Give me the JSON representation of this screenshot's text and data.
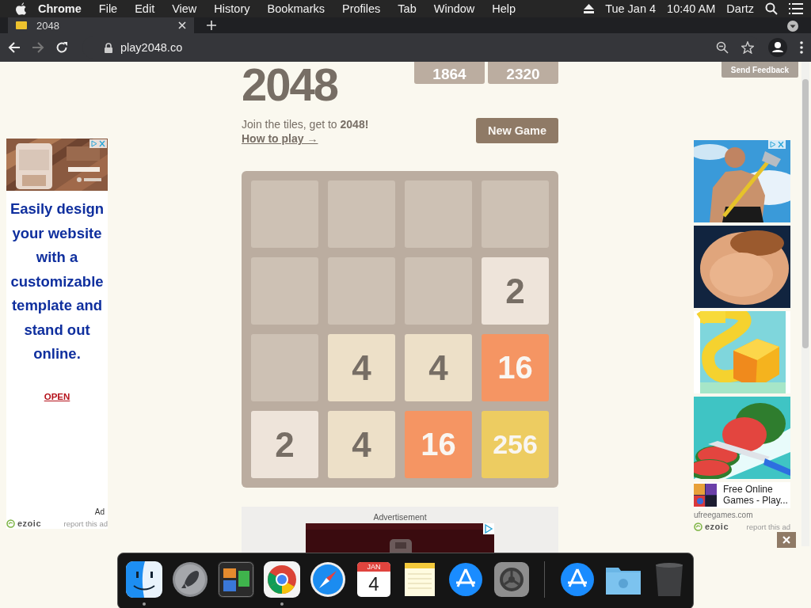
{
  "menubar": {
    "app": "Chrome",
    "menus": [
      "File",
      "Edit",
      "View",
      "History",
      "Bookmarks",
      "Profiles",
      "Tab",
      "Window",
      "Help"
    ],
    "date": "Tue Jan 4",
    "time": "10:40 AM",
    "user": "Dartz"
  },
  "tabs": [
    {
      "title": "2048",
      "selected": true
    }
  ],
  "address": "play2048.co",
  "send_feedback": "Send Feedback",
  "game": {
    "title": "2048",
    "scores": [
      "1864",
      "2320"
    ],
    "intro": "Join the tiles, get to **2048!**",
    "how_to_play": "How to play →",
    "new_game": "New Game",
    "grid": [
      [
        {
          "kind": "empty"
        },
        {
          "kind": "empty"
        },
        {
          "kind": "empty"
        },
        {
          "kind": "empty"
        }
      ],
      [
        {
          "kind": "empty"
        },
        {
          "kind": "empty"
        },
        {
          "kind": "empty"
        },
        {
          "kind": "tile",
          "value": "2"
        }
      ],
      [
        {
          "kind": "empty"
        },
        {
          "kind": "tile",
          "value": "4"
        },
        {
          "kind": "tile",
          "value": "4"
        },
        {
          "kind": "tile",
          "value": "16"
        }
      ],
      [
        {
          "kind": "tile",
          "value": "2"
        },
        {
          "kind": "tile",
          "value": "4"
        },
        {
          "kind": "tile",
          "value": "16"
        },
        {
          "kind": "tile",
          "value": "256"
        }
      ]
    ],
    "advertisement": "Advertisement"
  },
  "left_ad": {
    "headline": "Easily design your website with a customizable template and stand out online.",
    "link": "OPEN",
    "label": "Ad",
    "brand": "ezoic",
    "report": "report this ad"
  },
  "right_ad": {
    "caption": "Free Online Games - Play...",
    "domain": "ufreegames.com",
    "brand": "ezoic",
    "report": "report this ad"
  },
  "dock": [
    {
      "kind": "finder",
      "running": true
    },
    {
      "kind": "launchpad",
      "running": false
    },
    {
      "kind": "mission",
      "running": false
    },
    {
      "kind": "chrome",
      "running": true
    },
    {
      "kind": "safari",
      "running": false
    },
    {
      "kind": "calendar",
      "running": false,
      "month": "JAN",
      "day": "4"
    },
    {
      "kind": "notes",
      "running": false
    },
    {
      "kind": "appstore",
      "running": false
    },
    {
      "kind": "settings",
      "running": false
    },
    {
      "kind": "divider"
    },
    {
      "kind": "appstore",
      "running": false
    },
    {
      "kind": "folder",
      "running": false
    },
    {
      "kind": "trash",
      "running": false
    }
  ]
}
